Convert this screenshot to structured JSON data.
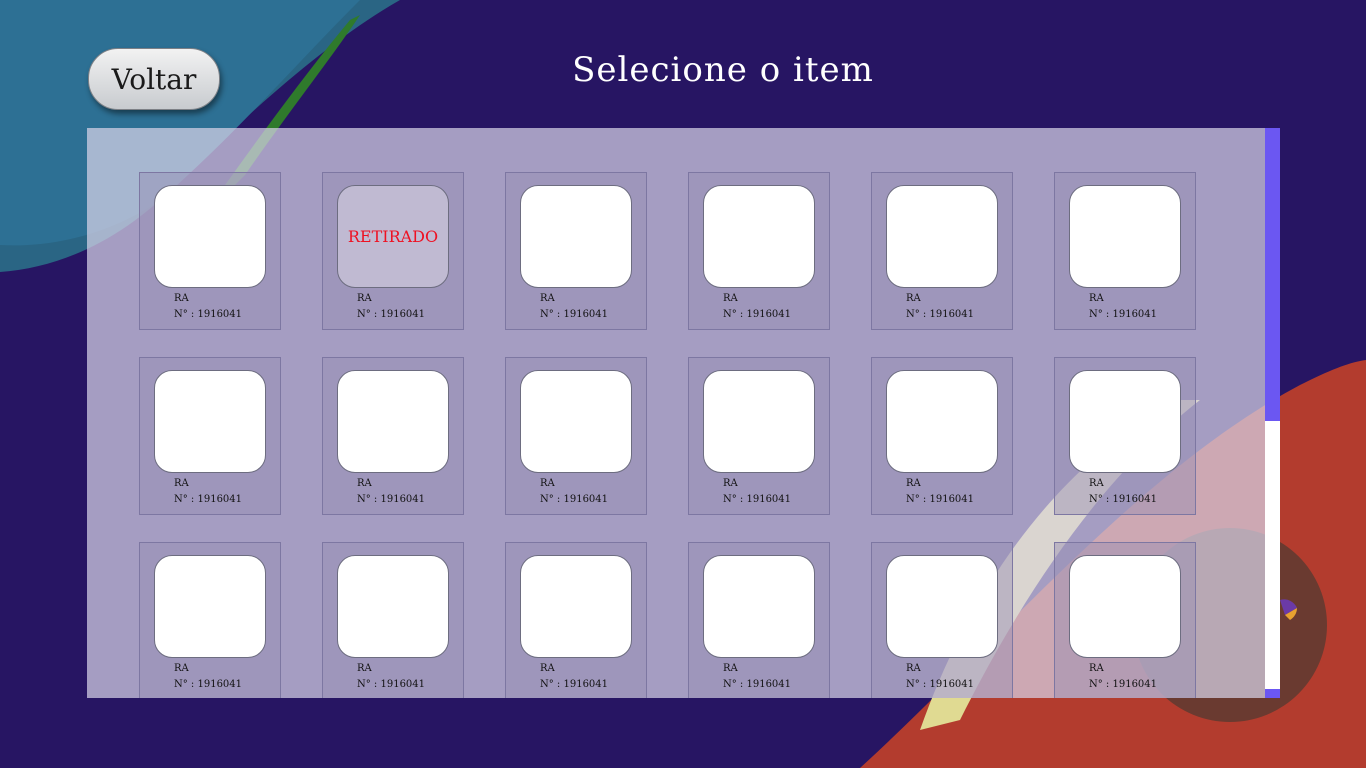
{
  "header": {
    "back_label": "Voltar",
    "title": "Selecione o item"
  },
  "grid": {
    "items": [
      {
        "ra": "RA",
        "number": "N° : 1916041",
        "status": ""
      },
      {
        "ra": "RA",
        "number": "N° : 1916041",
        "status": "RETIRADO"
      },
      {
        "ra": "RA",
        "number": "N° : 1916041",
        "status": ""
      },
      {
        "ra": "RA",
        "number": "N° : 1916041",
        "status": ""
      },
      {
        "ra": "RA",
        "number": "N° : 1916041",
        "status": ""
      },
      {
        "ra": "RA",
        "number": "N° : 1916041",
        "status": ""
      },
      {
        "ra": "RA",
        "number": "N° : 1916041",
        "status": ""
      },
      {
        "ra": "RA",
        "number": "N° : 1916041",
        "status": ""
      },
      {
        "ra": "RA",
        "number": "N° : 1916041",
        "status": ""
      },
      {
        "ra": "RA",
        "number": "N° : 1916041",
        "status": ""
      },
      {
        "ra": "RA",
        "number": "N° : 1916041",
        "status": ""
      },
      {
        "ra": "RA",
        "number": "N° : 1916041",
        "status": ""
      },
      {
        "ra": "RA",
        "number": "N° : 1916041",
        "status": ""
      },
      {
        "ra": "RA",
        "number": "N° : 1916041",
        "status": ""
      },
      {
        "ra": "RA",
        "number": "N° : 1916041",
        "status": ""
      },
      {
        "ra": "RA",
        "number": "N° : 1916041",
        "status": ""
      },
      {
        "ra": "RA",
        "number": "N° : 1916041",
        "status": ""
      },
      {
        "ra": "RA",
        "number": "N° : 1916041",
        "status": ""
      }
    ]
  },
  "colors": {
    "background": "#271563",
    "scroll_thumb": "#6b57f2",
    "taken_text": "#ee1122"
  }
}
